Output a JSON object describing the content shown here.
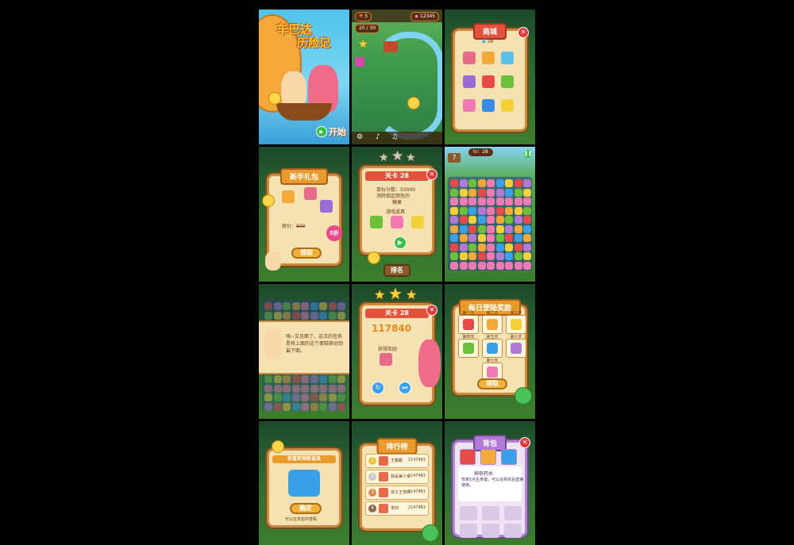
{
  "title_screen": {
    "game_title_line1": "车巴达",
    "game_title_line2": "历险记",
    "start_button": "开始"
  },
  "map_screen": {
    "lives": "5",
    "level_counter": "20 / 30",
    "coins": "12345"
  },
  "shop_screen": {
    "title": "商城",
    "balance": "38"
  },
  "gift_screen": {
    "title": "新手礼包",
    "price_label": "原价：",
    "price_value": "600",
    "discount_badge": "5折",
    "confirm_button": "领取"
  },
  "level_screen": {
    "title": "关卡 28",
    "target_label": "目标分数：",
    "target_value": "50000",
    "desc1": "消除指定颜色的",
    "desc2": "糖果",
    "items_header": "游戏道具",
    "start_button": "开始",
    "rank_button": "排名"
  },
  "board_screen": {
    "level_label": "lv：28",
    "moves": "7"
  },
  "tutorial_screen": {
    "dialog": "嗨~又见面了。这次的任务是将上面的这个蛋糕移动到最下面。"
  },
  "result_screen": {
    "title": "关卡 28",
    "score": "117840",
    "reward_label": "获得奖励"
  },
  "daily_screen": {
    "title": "每日登陆奖励",
    "days": [
      "第一天",
      "第二天",
      "第三天",
      "第四天",
      "第五天",
      "第六天",
      "第七天"
    ],
    "claim_button": "领取"
  },
  "item_get_screen": {
    "title": "恭喜获得新道具",
    "confirm_button": "确定",
    "hint": "可以在背包中查看"
  },
  "rank_screen": {
    "title": "排行榜",
    "rows": [
      {
        "rank": "1",
        "name": "王霸霸",
        "score": "2147483"
      },
      {
        "rank": "2",
        "name": "我是美少女",
        "score": "2147483"
      },
      {
        "rank": "3",
        "name": "孩子王李四",
        "score": "2147483"
      },
      {
        "rank": "4",
        "name": "李四",
        "score": "2147483"
      }
    ]
  },
  "bag_screen": {
    "title": "背包",
    "item_name": "神奇药水",
    "item_desc": "恢复5点生命值，可以在购买后直接使用。"
  },
  "colors": {
    "accent_red": "#e2533d",
    "scroll": "#f5e2b3",
    "wood": "#c98a3e",
    "green_button": "#6cc03a"
  }
}
